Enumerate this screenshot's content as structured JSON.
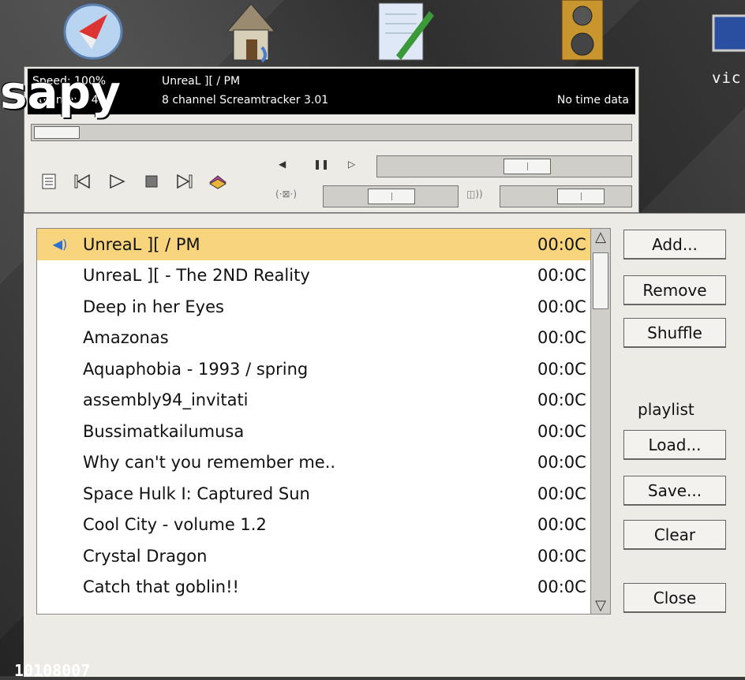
{
  "desktop": {
    "icons": [
      "compass-icon",
      "home-icon",
      "editor-icon",
      "speaker-icon",
      "monitor-icon"
    ],
    "label_right": "vic",
    "overlay_text": "sapy",
    "bottom_text": "10108007"
  },
  "player": {
    "speed_line": "Speed: 100%",
    "song_line": "UnreaL ][ / PM",
    "volume_line": "Volume: 5 4",
    "format_line": "8 channel Screamtracker 3.01",
    "time_text": "No time data",
    "seek_fraction": 0.0
  },
  "playlist": {
    "items": [
      {
        "title": "UnreaL ][ / PM",
        "time": "00:0C",
        "selected": true
      },
      {
        "title": "UnreaL ][ - The 2ND Reality",
        "time": "00:0C"
      },
      {
        "title": "Deep in her Eyes",
        "time": "00:0C"
      },
      {
        "title": "Amazonas",
        "time": "00:0C"
      },
      {
        "title": "Aquaphobia  - 1993 / spring",
        "time": "00:0C"
      },
      {
        "title": "assembly94_invitati",
        "time": "00:0C"
      },
      {
        "title": "Bussimatkailumusa",
        "time": "00:0C"
      },
      {
        "title": "Why can't you remember me..",
        "time": "00:0C"
      },
      {
        "title": "Space Hulk I: Captured Sun",
        "time": "00:0C"
      },
      {
        "title": "Cool City - volume 1.2",
        "time": "00:0C"
      },
      {
        "title": "Crystal Dragon",
        "time": "00:0C"
      },
      {
        "title": "Catch that goblin!!",
        "time": "00:0C"
      }
    ],
    "buttons": {
      "add": "Add...",
      "remove": "Remove",
      "shuffle": "Shuffle",
      "playlist_label": "playlist",
      "load": "Load...",
      "save": "Save...",
      "clear": "Clear",
      "close": "Close"
    }
  }
}
